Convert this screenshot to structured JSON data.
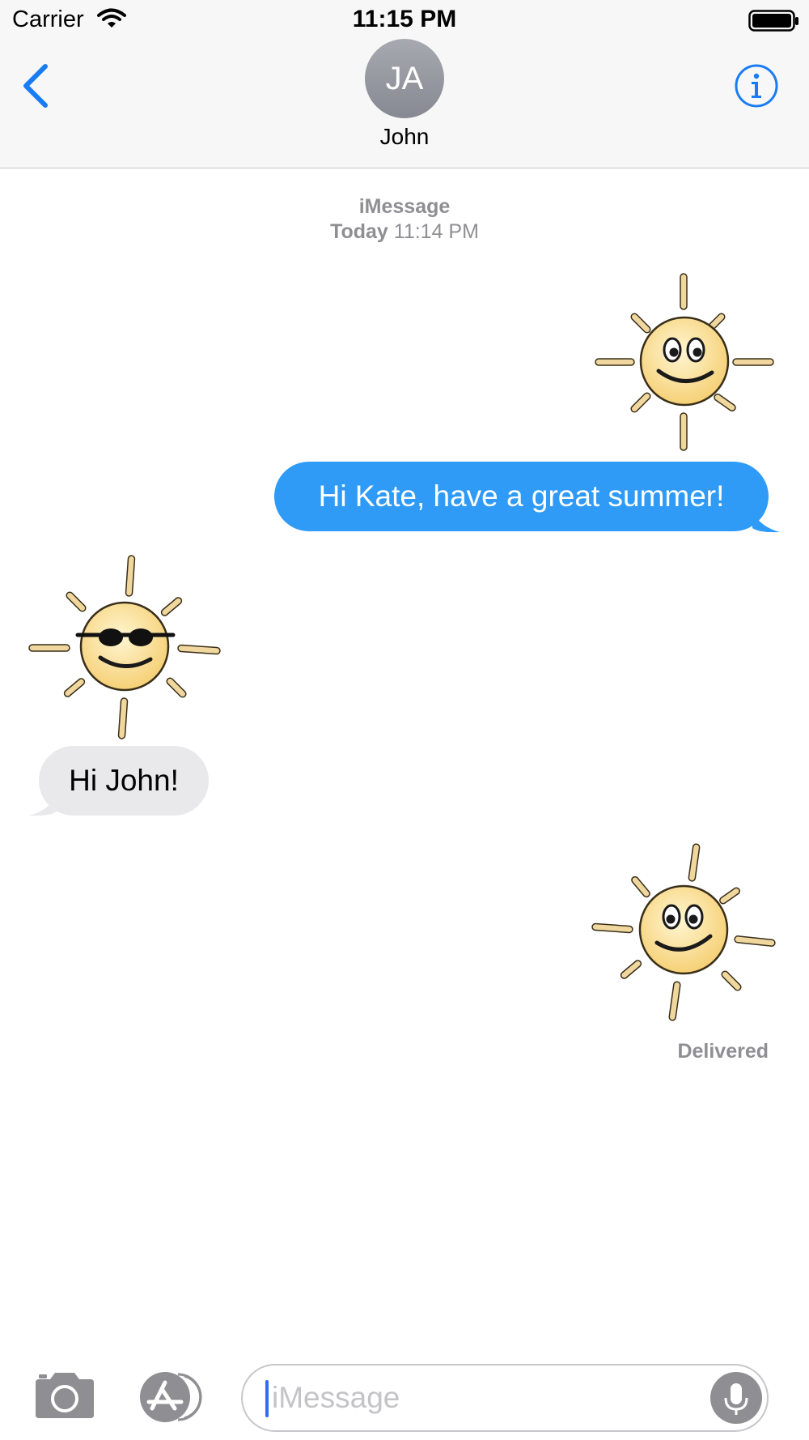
{
  "status_bar": {
    "carrier": "Carrier",
    "time": "11:15 PM"
  },
  "header": {
    "avatar_initials": "JA",
    "contact_name": "John"
  },
  "conversation": {
    "service": "iMessage",
    "timestamp_day": "Today",
    "timestamp_time": "11:14 PM",
    "messages": [
      {
        "from": "me",
        "type": "sticker",
        "sticker": "smiling-sun-sticker"
      },
      {
        "from": "me",
        "type": "text",
        "text": "Hi Kate, have a great summer!"
      },
      {
        "from": "them",
        "type": "sticker",
        "sticker": "sun-with-sunglasses-sticker"
      },
      {
        "from": "them",
        "type": "text",
        "text": "Hi John!"
      },
      {
        "from": "me",
        "type": "sticker",
        "sticker": "smiling-sun-sticker"
      }
    ],
    "delivery_status": "Delivered"
  },
  "compose": {
    "placeholder": "iMessage"
  },
  "colors": {
    "accent": "#1a7cf5",
    "outgoing_bubble": "#2f9bf7",
    "incoming_bubble": "#e9e9eb",
    "meta_text": "#8e8e93",
    "header_bg": "#f7f7f7",
    "sun_face": "#fbe49d",
    "sun_ray": "#efd79e"
  },
  "icons": [
    "wifi-icon",
    "battery-icon",
    "back-chevron-icon",
    "info-icon",
    "camera-icon",
    "app-store-icon",
    "microphone-icon"
  ]
}
